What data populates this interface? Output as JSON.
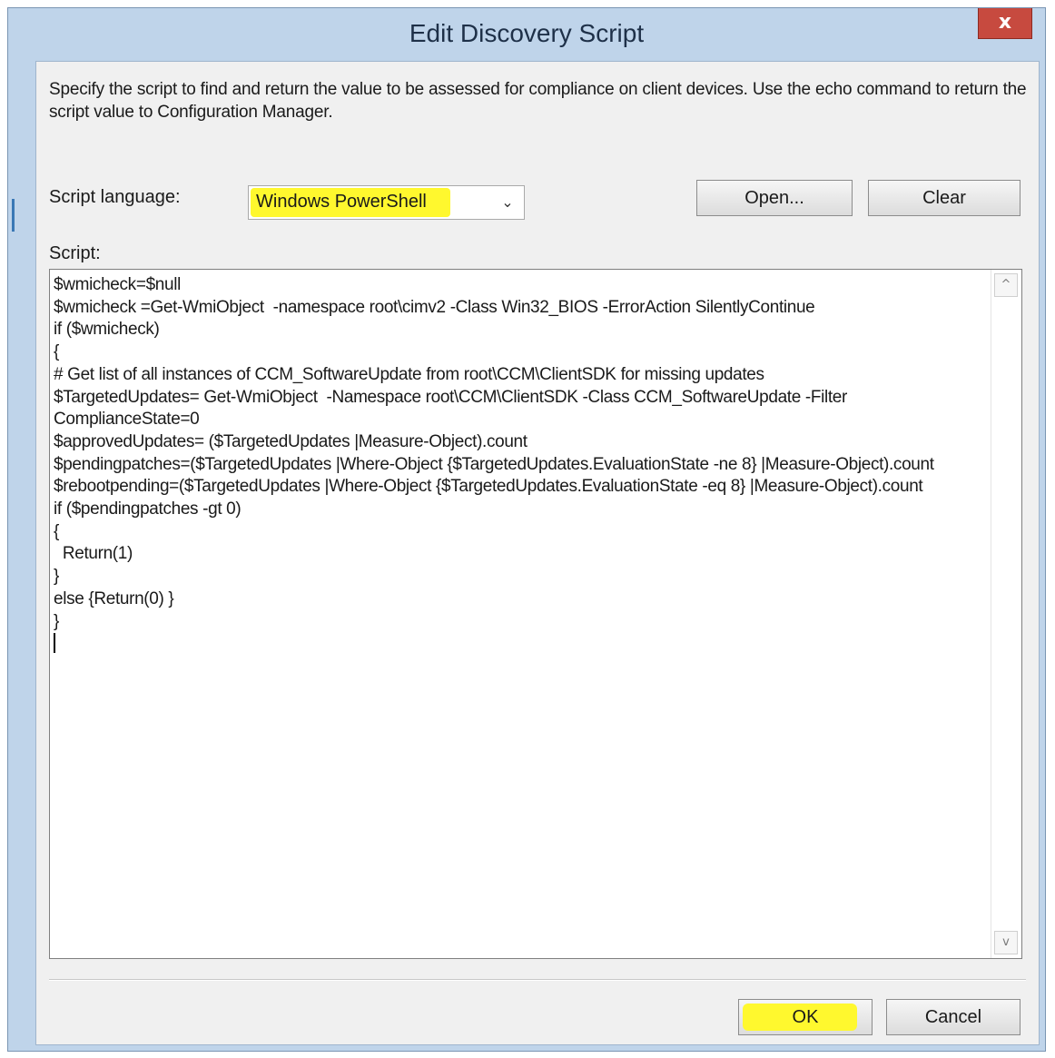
{
  "window": {
    "title": "Edit Discovery Script",
    "close_glyph": "x"
  },
  "description": "Specify the script to find and return the value to be assessed for compliance on client devices. Use the echo command to return the script value to Configuration Manager.",
  "script_language": {
    "label": "Script language:",
    "selected": "Windows PowerShell",
    "dropdown_icon": "chevron-down-icon"
  },
  "buttons": {
    "open": "Open...",
    "clear": "Clear",
    "ok": "OK",
    "cancel": "Cancel"
  },
  "script": {
    "label": "Script:",
    "lines": [
      "$wmicheck=$null",
      "$wmicheck =Get-WmiObject  -namespace root\\cimv2 -Class Win32_BIOS -ErrorAction SilentlyContinue",
      "if ($wmicheck)",
      "{",
      "# Get list of all instances of CCM_SoftwareUpdate from root\\CCM\\ClientSDK for missing updates",
      "$TargetedUpdates= Get-WmiObject  -Namespace root\\CCM\\ClientSDK -Class CCM_SoftwareUpdate -Filter ComplianceState=0",
      "$approvedUpdates= ($TargetedUpdates |Measure-Object).count",
      "$pendingpatches=($TargetedUpdates |Where-Object {$TargetedUpdates.EvaluationState -ne 8} |Measure-Object).count",
      "$rebootpending=($TargetedUpdates |Where-Object {$TargetedUpdates.EvaluationState -eq 8} |Measure-Object).count",
      "if ($pendingpatches -gt 0)",
      "{",
      "  Return(1)",
      "}",
      "else {Return(0) }",
      "}",
      ""
    ]
  },
  "scrollbar": {
    "up_glyph": "^",
    "down_glyph": "v"
  },
  "highlight_color": "#fff82e"
}
